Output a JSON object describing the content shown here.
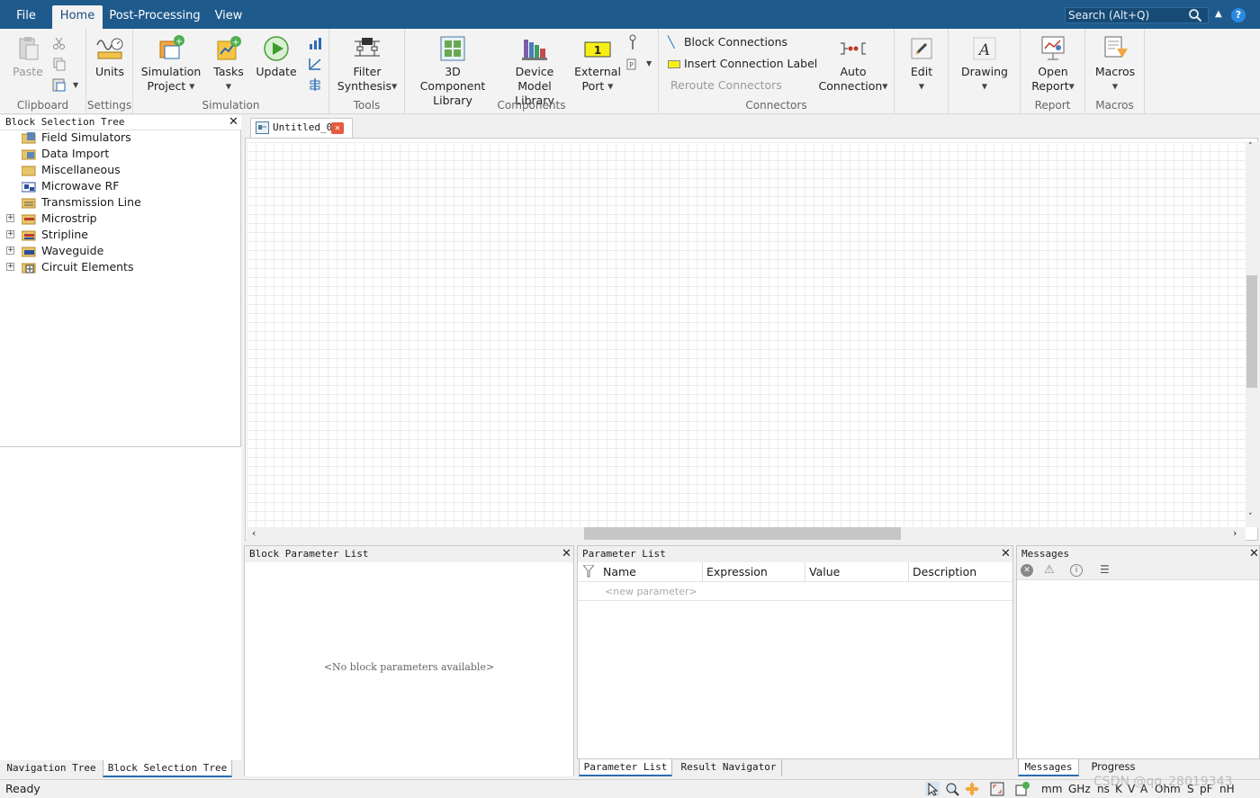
{
  "menu": {
    "file": "File",
    "home": "Home",
    "post_processing": "Post-Processing",
    "view": "View",
    "search_placeholder": "Search (Alt+Q)"
  },
  "ribbon": {
    "clipboard": {
      "label": "Clipboard",
      "paste": "Paste"
    },
    "settings": {
      "label": "Settings",
      "units": "Units"
    },
    "simulation": {
      "label": "Simulation",
      "project_l1": "Simulation",
      "project_l2": "Project",
      "tasks": "Tasks",
      "update": "Update"
    },
    "tools": {
      "label": "Tools",
      "filter_l1": "Filter",
      "filter_l2": "Synthesis"
    },
    "components": {
      "label": "Components",
      "c3d_l1": "3D Component",
      "c3d_l2": "Library",
      "device_l1": "Device Model",
      "device_l2": "Library",
      "ext_l1": "External",
      "ext_l2": "Port"
    },
    "connectors": {
      "label": "Connectors",
      "block_connections": "Block Connections",
      "insert_label": "Insert Connection Label",
      "reroute": "Reroute Connectors",
      "auto_l1": "Auto",
      "auto_l2": "Connection"
    },
    "edit": "Edit",
    "drawing": "Drawing",
    "report": {
      "label": "Report",
      "open_l1": "Open",
      "open_l2": "Report"
    },
    "macros": {
      "label": "Macros",
      "macros": "Macros"
    }
  },
  "left": {
    "header": "Block Selection Tree",
    "items": [
      "Field Simulators",
      "Data Import",
      "Miscellaneous",
      "Microwave RF",
      "Transmission Line",
      "Microstrip",
      "Stripline",
      "Waveguide",
      "Circuit Elements"
    ],
    "tab_nav": "Navigation Tree",
    "tab_block": "Block Selection Tree"
  },
  "doc_tab": "Untitled_0",
  "block_params": {
    "title": "Block Parameter List",
    "empty": "<No block parameters available>"
  },
  "param_list": {
    "title": "Parameter List",
    "columns": [
      "Name",
      "Expression",
      "Value",
      "Description"
    ],
    "new_param": "<new parameter>",
    "tab_params": "Parameter List",
    "tab_results": "Result Navigator"
  },
  "messages": {
    "title": "Messages",
    "tab_messages": "Messages",
    "tab_progress": "Progress"
  },
  "status": {
    "text": "Ready",
    "units": [
      "mm",
      "GHz",
      "ns",
      "K",
      "V",
      "A",
      "Ohm",
      "S",
      "pF",
      "nH"
    ]
  },
  "watermark": "CSDN @qq_28019343"
}
